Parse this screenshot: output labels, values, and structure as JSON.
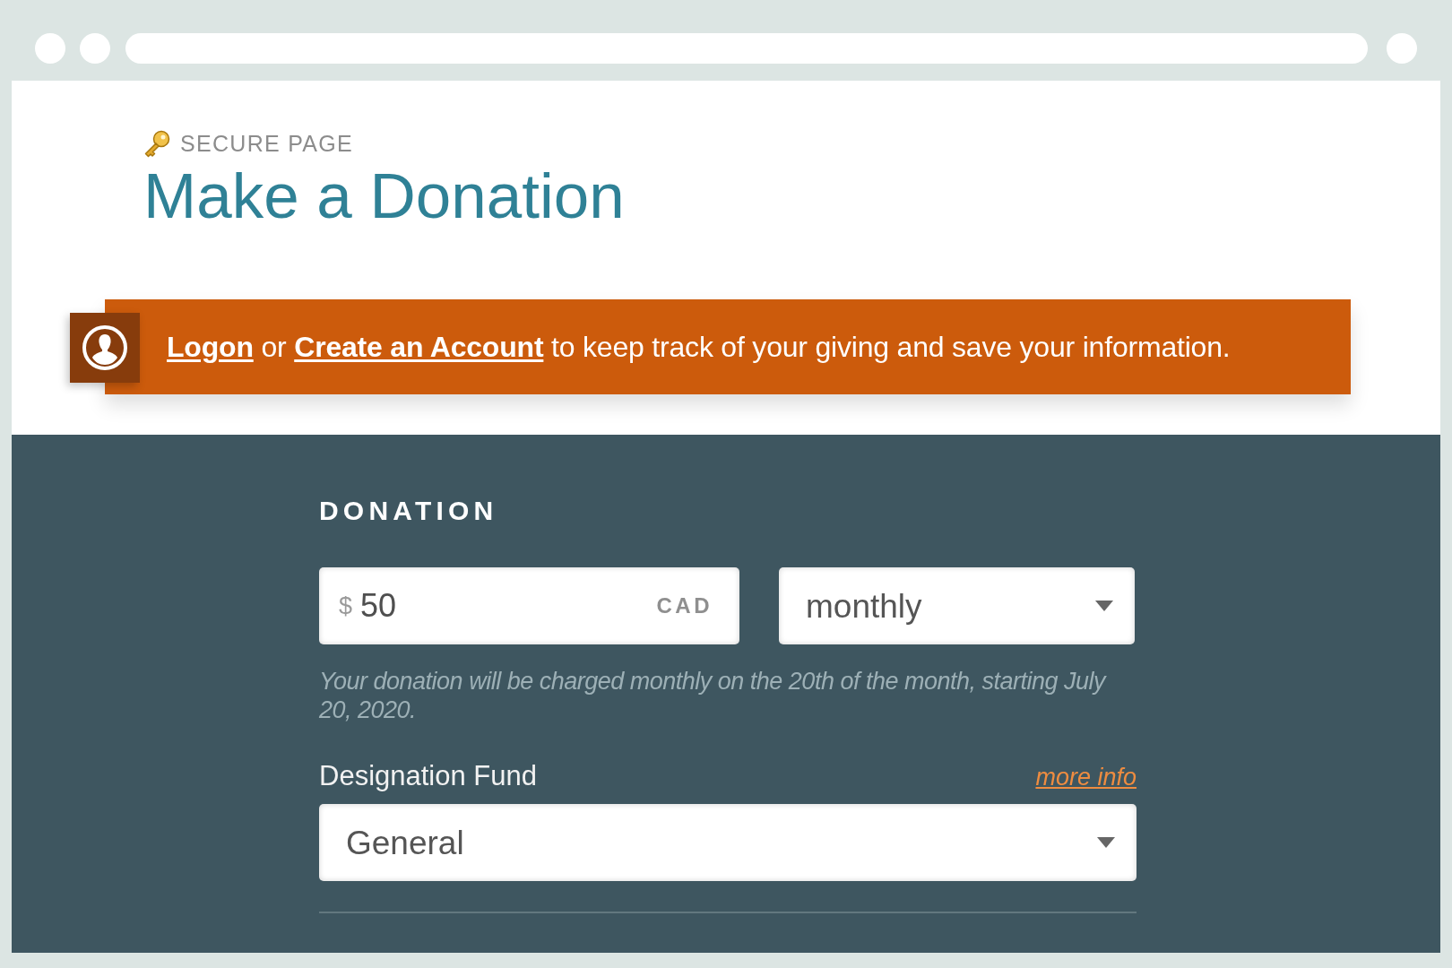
{
  "header": {
    "secure_label": "SECURE PAGE",
    "title": "Make a Donation"
  },
  "account_banner": {
    "segments": [
      {
        "kind": "link",
        "text": "Logon"
      },
      {
        "kind": "plain",
        "text": "or"
      },
      {
        "kind": "link",
        "text": "Create an Account"
      },
      {
        "kind": "plain",
        "text": "to keep track of your giving and save your information."
      }
    ]
  },
  "donation": {
    "heading": "DONATION",
    "amount": {
      "currency_symbol": "$",
      "value": "50",
      "currency": "CAD"
    },
    "frequency": {
      "value": "monthly"
    },
    "schedule_note": "Your donation will be charged monthly on the 20th of the month, starting July 20, 2020.",
    "designation": {
      "label": "Designation Fund",
      "link": "more info",
      "value": "General"
    }
  }
}
